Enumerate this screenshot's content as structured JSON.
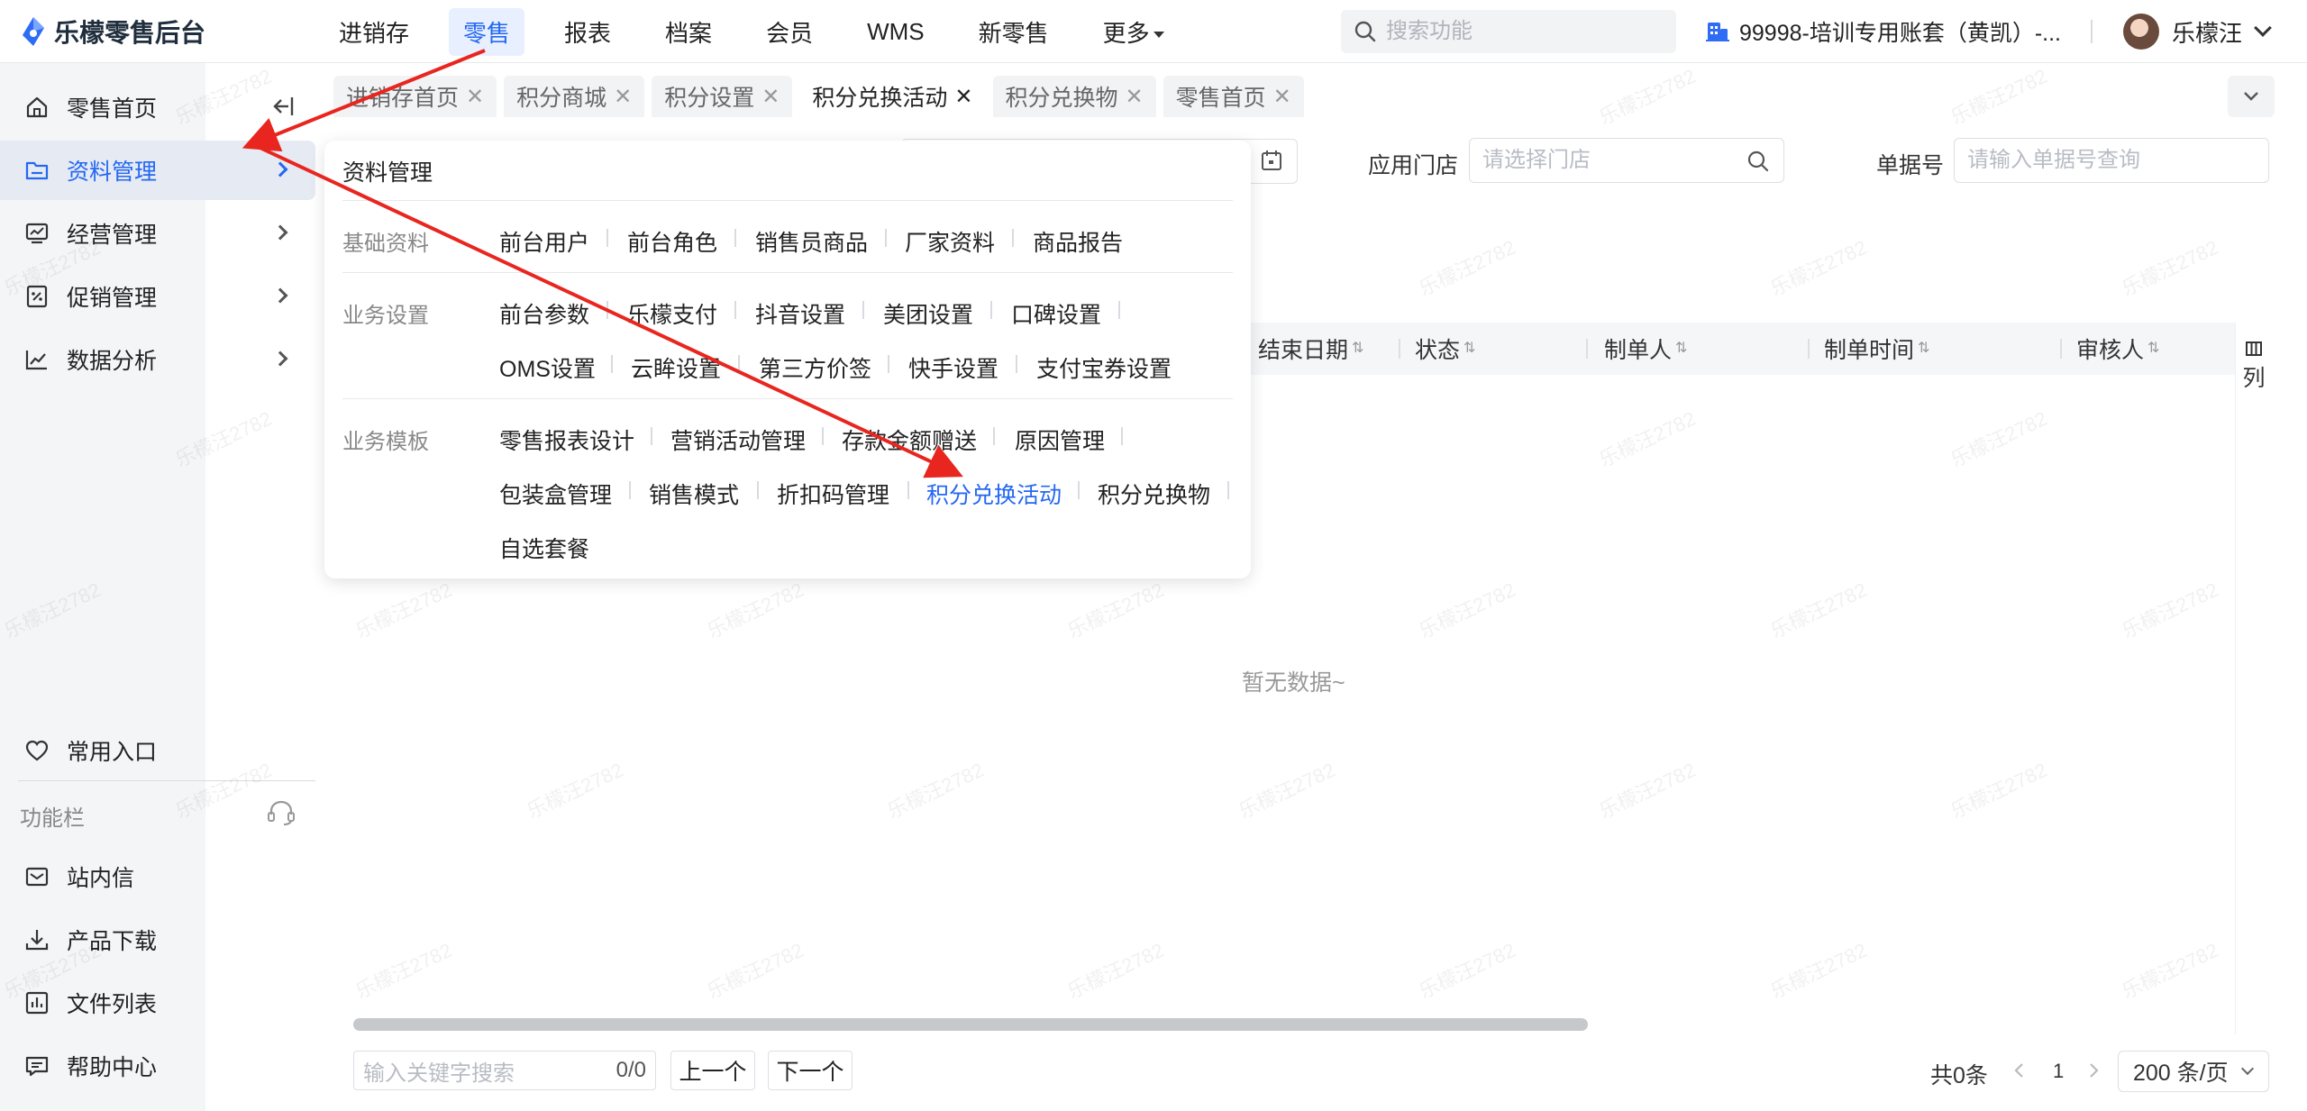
{
  "app": {
    "title": "乐檬零售后台"
  },
  "nav": {
    "items": [
      "进销存",
      "零售",
      "报表",
      "档案",
      "会员",
      "WMS",
      "新零售",
      "更多"
    ],
    "active": "零售"
  },
  "search": {
    "placeholder": "搜索功能"
  },
  "account": {
    "name": "99998-培训专用账套（黄凯）-..."
  },
  "user": {
    "name": "乐檬汪"
  },
  "sidebar": {
    "items": [
      {
        "label": "零售首页",
        "icon": "home-icon"
      },
      {
        "label": "资料管理",
        "icon": "folder-icon"
      },
      {
        "label": "经营管理",
        "icon": "monitor-chart-icon"
      },
      {
        "label": "促销管理",
        "icon": "promo-icon"
      },
      {
        "label": "数据分析",
        "icon": "line-chart-icon"
      }
    ],
    "bottom_items": [
      {
        "label": "常用入口",
        "icon": "heart-icon"
      },
      {
        "label": "站内信",
        "icon": "mail-icon"
      },
      {
        "label": "产品下载",
        "icon": "download-icon"
      },
      {
        "label": "文件列表",
        "icon": "file-chart-icon"
      },
      {
        "label": "帮助中心",
        "icon": "help-chat-icon"
      }
    ],
    "function_bar_label": "功能栏"
  },
  "tabs": [
    "进销存首页",
    "积分商城",
    "积分设置",
    "积分兑换活动",
    "积分兑换物",
    "零售首页"
  ],
  "active_tab": "积分兑换活动",
  "filters": {
    "store_label": "应用门店",
    "store_placeholder": "请选择门店",
    "doc_label": "单据号",
    "doc_placeholder": "请输入单据号查询"
  },
  "table": {
    "columns": [
      "结束日期",
      "状态",
      "制单人",
      "制单时间",
      "审核人"
    ],
    "column_setting_label": "列",
    "empty_text": "暂无数据~"
  },
  "footer": {
    "keyword_placeholder": "输入关键字搜索",
    "match_count": "0/0",
    "prev_label": "上一个",
    "next_label": "下一个",
    "total_text": "共0条",
    "page_number": "1",
    "page_size": "200 条/页"
  },
  "menu": {
    "title": "资料管理",
    "groups": [
      {
        "label": "基础资料",
        "items": [
          "前台用户",
          "前台角色",
          "销售员商品",
          "厂家资料",
          "商品报告"
        ]
      },
      {
        "label": "业务设置",
        "items": [
          "前台参数",
          "乐檬支付",
          "抖音设置",
          "美团设置",
          "口碑设置",
          "OMS设置",
          "云眸设置",
          "第三方价签",
          "快手设置",
          "支付宝券设置"
        ]
      },
      {
        "label": "业务模板",
        "items": [
          "零售报表设计",
          "营销活动管理",
          "存款金额赠送",
          "原因管理",
          "包装盒管理",
          "销售模式",
          "折扣码管理",
          "积分兑换活动",
          "积分兑换物",
          "自选套餐"
        ]
      }
    ],
    "highlighted_item": "积分兑换活动"
  },
  "watermark": "乐檬汪2782",
  "colors": {
    "accent": "#2468f2",
    "annotation": "#e8261f"
  }
}
